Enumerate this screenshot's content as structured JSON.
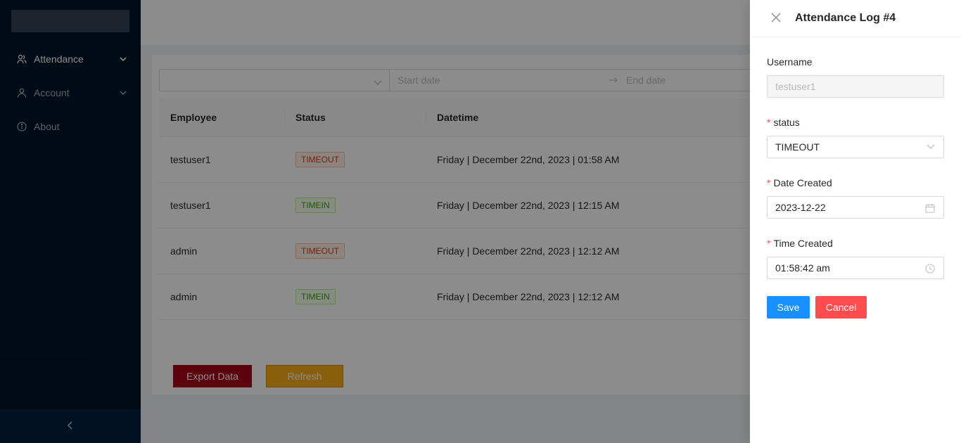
{
  "sidebar": {
    "items": [
      {
        "label": "Attendance",
        "icon": "team-icon"
      },
      {
        "label": "Account",
        "icon": "user-icon"
      },
      {
        "label": "About",
        "icon": "info-icon"
      }
    ]
  },
  "filter": {
    "start_placeholder": "Start date",
    "end_placeholder": "End date"
  },
  "table": {
    "columns": [
      "Employee",
      "Status",
      "Datetime"
    ],
    "rows": [
      {
        "employee": "testuser1",
        "status": "TIMEOUT",
        "datetime": "Friday | December 22nd, 2023 | 01:58 AM"
      },
      {
        "employee": "testuser1",
        "status": "TIMEIN",
        "datetime": "Friday | December 22nd, 2023 | 12:15 AM"
      },
      {
        "employee": "admin",
        "status": "TIMEOUT",
        "datetime": "Friday | December 22nd, 2023 | 12:12 AM"
      },
      {
        "employee": "admin",
        "status": "TIMEIN",
        "datetime": "Friday | December 22nd, 2023 | 12:12 AM"
      }
    ]
  },
  "actions": {
    "export_label": "Export Data",
    "refresh_label": "Refresh"
  },
  "drawer": {
    "title": "Attendance Log #4",
    "username_label": "Username",
    "username_value": "testuser1",
    "status_label": "status",
    "status_value": "TIMEOUT",
    "date_label": "Date Created",
    "date_value": "2023-12-22",
    "time_label": "Time Created",
    "time_value": "01:58:42 am",
    "save_label": "Save",
    "cancel_label": "Cancel"
  },
  "colors": {
    "sidebar": "#001529",
    "primary": "#1890ff",
    "danger": "#ff4d4f",
    "export": "#a8071a",
    "refresh": "#faad14"
  }
}
